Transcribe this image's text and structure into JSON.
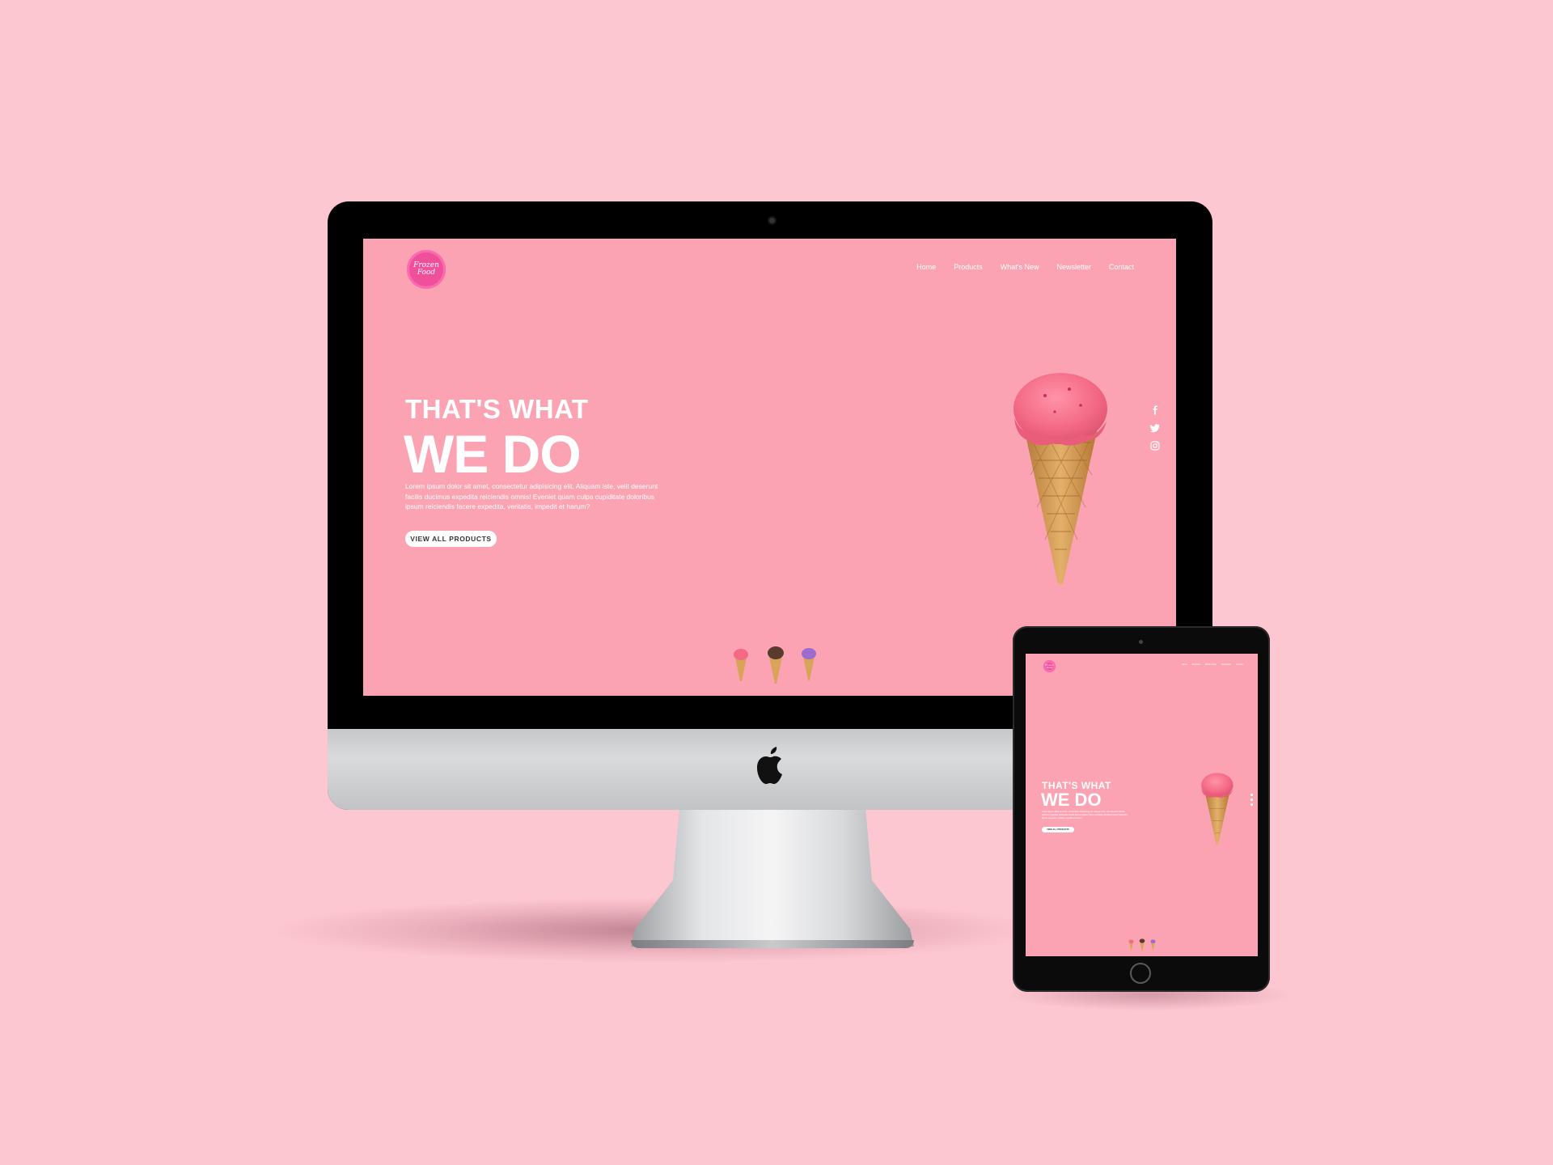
{
  "site": {
    "logo_text": "Frozen Food",
    "nav": [
      "Home",
      "Products",
      "What's New",
      "Newsletter",
      "Contact"
    ],
    "headline_small": "THAT'S WHAT",
    "headline_large": "WE DO",
    "body": "Lorem ipsum dolor sit amet, consectetur adipisicing elit. Aliquam iste, velit deserunt facilis ducimus expedita reiciendis omnis! Eveniet quam culpa cupiditate doloribus ipsum reiciendis facere expedita, veritatis, impedit et harum?",
    "cta_label": "VIEW ALL PRODUCTS",
    "social_icons": [
      "facebook-icon",
      "twitter-icon",
      "instagram-icon"
    ],
    "thumbnails": [
      "strawberry",
      "chocolate",
      "blueberry"
    ]
  },
  "colors": {
    "background": "#fdc7d1",
    "screen": "#fca3b3",
    "logo": "#f0509b",
    "scoop_strawberry": "#f46a86",
    "scoop_chocolate": "#5a3a2e",
    "scoop_blueberry": "#9b6bd0",
    "cone": "#d9a35a"
  }
}
